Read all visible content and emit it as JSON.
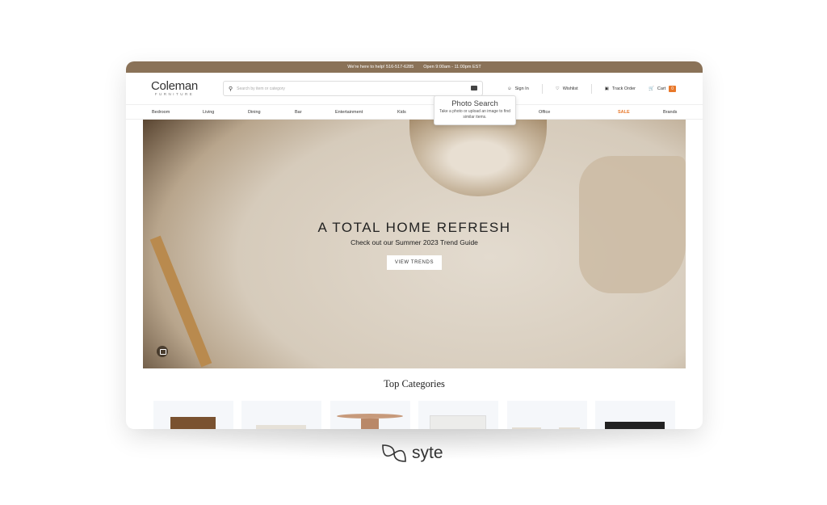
{
  "topbar": {
    "help": "We're here to help!  516-517-6285",
    "hours": "Open  9:00am - 11:00pm EST"
  },
  "brand": {
    "name": "Coleman",
    "sub": "FURNITURE"
  },
  "search": {
    "placeholder": "Search by item or category"
  },
  "actions": {
    "sign_in": "Sign In",
    "wishlist": "Wishlist",
    "track": "Track Order",
    "cart": "Cart",
    "cart_count": "0"
  },
  "nav": [
    "Bedroom",
    "Living",
    "Dining",
    "Bar",
    "Entertainment",
    "Kids",
    "Office",
    "SALE",
    "Brands"
  ],
  "tooltip": {
    "title": "Photo Search",
    "desc": "Take a photo or upload an image to find similar items."
  },
  "hero": {
    "title": "A TOTAL HOME REFRESH",
    "subtitle": "Check out our Summer 2023 Trend Guide",
    "button": "VIEW TRENDS"
  },
  "section_title": "Top Categories",
  "footer_logo": "syte",
  "colors": {
    "topbar": "#8a7258",
    "sale": "#e8782a",
    "cart_badge": "#e8782a"
  }
}
